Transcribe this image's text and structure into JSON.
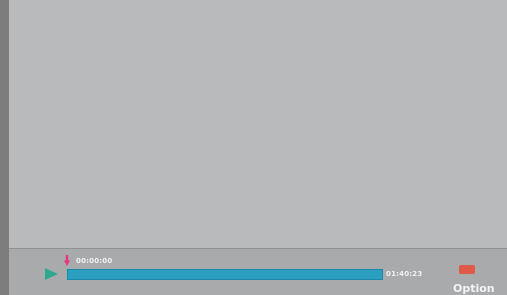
{
  "player": {
    "current_time": "00:00:00",
    "total_time": "01:40:23",
    "progress_fraction": 0,
    "play_icon": "play-icon",
    "position_marker_icon": "down-arrow-icon"
  },
  "option": {
    "label": "Option",
    "swatch_color": "#e05a4a",
    "swatch_name": "red-button-icon"
  },
  "colors": {
    "play": "#2fa88f",
    "marker": "#e8357f",
    "progress": "#36b6d6"
  }
}
